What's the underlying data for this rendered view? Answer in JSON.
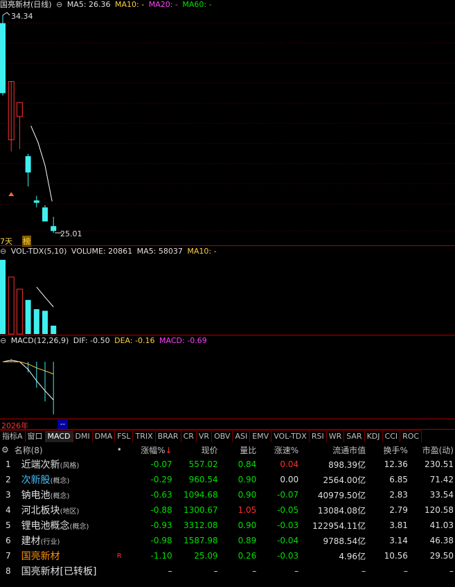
{
  "price_panel": {
    "title": "国亮新材(日线)",
    "ma5": "MA5: 26.36",
    "ma10": "MA10: -",
    "ma20": "MA20: -",
    "ma60": "MA60: -",
    "high_label": "34.34",
    "low_label": "25.01",
    "days_label": "7天",
    "bang_label": "榜"
  },
  "vol_panel": {
    "title": "VOL-TDX(5,10)",
    "volume": "VOLUME: 20861",
    "ma5": "MA5: 58037",
    "ma10": "MA10: -"
  },
  "macd_panel": {
    "title": "MACD(12,26,9)",
    "dif": "DIF: -0.50",
    "dea": "DEA: -0.16",
    "macd": "MACD: -0.69"
  },
  "timeline": {
    "year": "2026年",
    "marker": "--"
  },
  "indicator_tabs": [
    "指标A",
    "窗口",
    "MACD",
    "DMI",
    "DMA",
    "FSL",
    "TRIX",
    "BRAR",
    "CR",
    "VR",
    "OBV",
    "ASI",
    "EMV",
    "VOL-TDX",
    "RSI",
    "WR",
    "SAR",
    "KDJ",
    "CCI",
    "ROC"
  ],
  "active_tab": "MACD",
  "table": {
    "headers": {
      "name": "名称(8)",
      "dot": "•",
      "chg": "涨幅%",
      "price": "现价",
      "vr": "量比",
      "speed": "涨速%",
      "cap": "流通市值",
      "turn": "换手%",
      "pe": "市盈(动)"
    },
    "rows": [
      {
        "idx": "1",
        "name": "近端次新",
        "tag": "(风格)",
        "chg": "-0.07",
        "price": "557.02",
        "vr": "0.84",
        "speed": "0.04",
        "cap": "898.39亿",
        "turn": "12.36",
        "pe": "230.51",
        "flag": ""
      },
      {
        "idx": "2",
        "name": "次新股",
        "tag": "(概念)",
        "chg": "-0.29",
        "price": "960.54",
        "vr": "0.90",
        "speed": "0.00",
        "cap": "2564.00亿",
        "turn": "6.85",
        "pe": "71.42",
        "flag": ""
      },
      {
        "idx": "3",
        "name": "钠电池",
        "tag": "(概念)",
        "chg": "-0.63",
        "price": "1094.68",
        "vr": "0.90",
        "speed": "-0.07",
        "cap": "40979.50亿",
        "turn": "2.83",
        "pe": "33.54",
        "flag": ""
      },
      {
        "idx": "4",
        "name": "河北板块",
        "tag": "(地区)",
        "chg": "-0.88",
        "price": "1300.67",
        "vr": "1.05",
        "speed": "-0.05",
        "cap": "13084.08亿",
        "turn": "2.79",
        "pe": "120.58",
        "flag": ""
      },
      {
        "idx": "5",
        "name": "锂电池概念",
        "tag": "(概念)",
        "chg": "-0.93",
        "price": "3312.08",
        "vr": "0.90",
        "speed": "-0.03",
        "cap": "122954.11亿",
        "turn": "3.81",
        "pe": "41.03",
        "flag": ""
      },
      {
        "idx": "6",
        "name": "建材",
        "tag": "(行业)",
        "chg": "-0.98",
        "price": "1587.98",
        "vr": "0.89",
        "speed": "-0.04",
        "cap": "9788.54亿",
        "turn": "3.14",
        "pe": "46.38",
        "flag": ""
      },
      {
        "idx": "7",
        "name": "国亮新材",
        "tag": "",
        "chg": "-1.10",
        "price": "25.09",
        "vr": "0.26",
        "speed": "-0.03",
        "cap": "4.96亿",
        "turn": "10.56",
        "pe": "29.50",
        "flag": "R"
      },
      {
        "idx": "8",
        "name": "国亮新材[已转板]",
        "tag": "",
        "chg": "–",
        "price": "–",
        "vr": "–",
        "speed": "–",
        "cap": "–",
        "turn": "–",
        "pe": "–",
        "flag": ""
      }
    ]
  },
  "colors": {
    "bull": "#ff3030",
    "bear": "#40f0f0",
    "grid": "#b00000",
    "ma5": "#ffffff"
  },
  "chart_data": [
    {
      "type": "candlestick",
      "title": "国亮新材(日线)",
      "x": [
        1,
        2,
        3,
        4,
        5,
        6,
        7
      ],
      "ohlc": [
        {
          "open": 34.0,
          "high": 34.34,
          "close": 31.0,
          "low": 30.9
        },
        {
          "open": 29.0,
          "high": 31.5,
          "close": 31.5,
          "low": 28.5
        },
        {
          "open": 30.0,
          "high": 30.0,
          "close": 30.6,
          "low": 28.6
        },
        {
          "open": 28.3,
          "high": 28.4,
          "close": 27.6,
          "low": 27.0
        },
        {
          "open": 26.4,
          "high": 26.6,
          "close": 26.3,
          "low": 26.1
        },
        {
          "open": 26.1,
          "high": 26.2,
          "close": 25.5,
          "low": 25.5
        },
        {
          "open": 25.3,
          "high": 25.7,
          "close": 25.09,
          "low": 25.01
        }
      ],
      "ylim": [
        25.01,
        34.34
      ]
    },
    {
      "type": "bar",
      "title": "VOL-TDX(5,10)",
      "x": [
        1,
        2,
        3,
        4,
        5,
        6,
        7
      ],
      "values": [
        185000,
        142000,
        112000,
        85000,
        62000,
        58000,
        20861
      ],
      "ma5": [
        null,
        null,
        null,
        null,
        117200,
        91800,
        67572
      ]
    },
    {
      "type": "bar",
      "title": "MACD(12,26,9)",
      "x": [
        1,
        2,
        3,
        4,
        5,
        6,
        7
      ],
      "dif": [
        0.0,
        0.02,
        0.0,
        -0.1,
        -0.25,
        -0.38,
        -0.5
      ],
      "dea": [
        0.0,
        0.0,
        0.0,
        -0.03,
        -0.08,
        -0.12,
        -0.16
      ],
      "macd": [
        0.0,
        0.04,
        0.0,
        -0.14,
        -0.34,
        -0.52,
        -0.69
      ]
    }
  ]
}
